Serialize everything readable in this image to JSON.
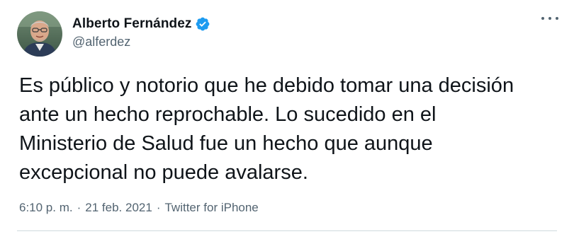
{
  "author": {
    "display_name": "Alberto Fernández",
    "handle": "@alferdez",
    "verified": true,
    "avatar_icon": "profile-photo",
    "verified_icon": "verified-badge-icon",
    "verified_color": "#1d9bf0"
  },
  "menu": {
    "icon": "more-options-icon"
  },
  "tweet": {
    "text": "Es público y notorio que he debido tomar una decisión\nante un hecho reprochable. Lo sucedido en el\nMinisterio de Salud fue un hecho que aunque\nexcepcional no puede avalarse.",
    "time": "6:10 p. m.",
    "separator": "·",
    "date": "21 feb. 2021",
    "source": "Twitter for iPhone"
  },
  "colors": {
    "text": "#0f1419",
    "secondary": "#536471",
    "divider": "#cfd9de"
  }
}
